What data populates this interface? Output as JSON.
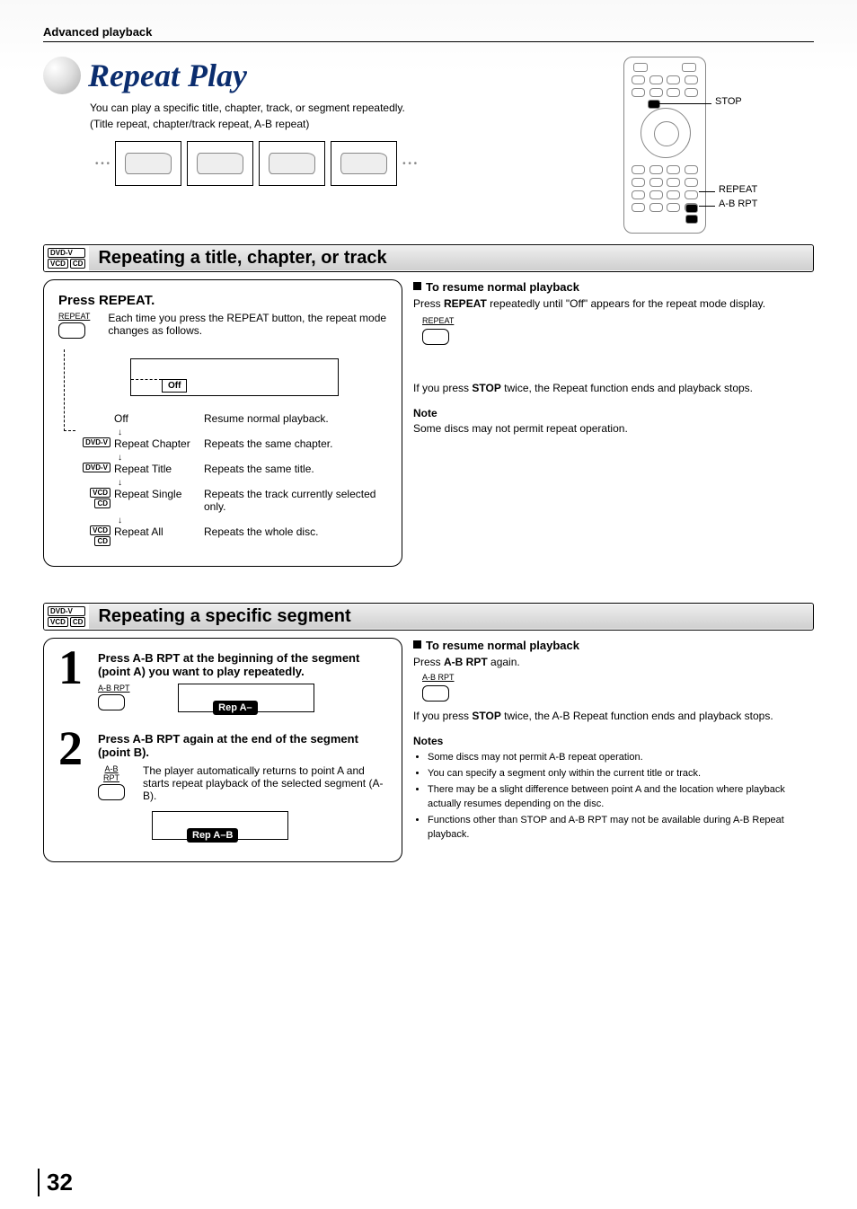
{
  "header": {
    "section": "Advanced playback"
  },
  "title": {
    "heading": "Repeat Play",
    "intro_l1": "You can play a specific title, chapter, track, or segment repeatedly.",
    "intro_l2": "(Title repeat, chapter/track repeat, A-B repeat)"
  },
  "remote": {
    "stop": "STOP",
    "repeat": "REPEAT",
    "abrpt": "A-B RPT"
  },
  "media_tags": {
    "dvdv": "DVD-V",
    "vcd": "VCD",
    "cd": "CD"
  },
  "section1": {
    "title": "Repeating a title, chapter, or track",
    "panel_head": "Press REPEAT.",
    "panel_body": "Each time you press the REPEAT button, the repeat mode changes as follows.",
    "btn_label": "REPEAT",
    "osd_off": "Off",
    "modes": {
      "off_name": "Off",
      "off_desc": "Resume normal playback.",
      "rc_name": "Repeat Chapter",
      "rc_desc": "Repeats the same chapter.",
      "rt_name": "Repeat Title",
      "rt_desc": "Repeats the same title.",
      "rs_name": "Repeat Single",
      "rs_desc": "Repeats the track currently selected only.",
      "ra_name": "Repeat All",
      "ra_desc": "Repeats the whole disc."
    },
    "right": {
      "resume_head": "To resume normal playback",
      "resume_body_a": "Press ",
      "resume_body_b": "REPEAT",
      "resume_body_c": " repeatedly until \"Off\" appears for the repeat mode display.",
      "btn_label": "REPEAT",
      "stop_body_a": "If you press ",
      "stop_body_b": "STOP",
      "stop_body_c": " twice, the Repeat function ends and playback stops.",
      "note_head": "Note",
      "note_body": "Some discs may not permit repeat operation."
    }
  },
  "section2": {
    "title": "Repeating a specific segment",
    "step1_num": "1",
    "step1_text": "Press A-B RPT at the beginning of the segment (point A) you want to play repeatedly.",
    "step1_btn": "A-B RPT",
    "step1_chip": "Rep A–",
    "step2_num": "2",
    "step2_text": "Press A-B RPT again at the end of the segment (point B).",
    "step2_btn": "A-B RPT",
    "step2_body": "The player automatically returns to point A and starts repeat playback of the selected segment (A-B).",
    "step2_chip": "Rep A–B",
    "right": {
      "resume_head": "To resume normal playback",
      "resume_body_a": "Press ",
      "resume_body_b": "A-B RPT",
      "resume_body_c": " again.",
      "btn_label": "A-B RPT",
      "stop_body_a": "If you press ",
      "stop_body_b": "STOP",
      "stop_body_c": " twice, the A-B Repeat function ends and playback stops.",
      "notes_head": "Notes",
      "n1": "Some discs may not permit A-B repeat operation.",
      "n2": "You can specify a segment only within the current title or track.",
      "n3": "There may be a slight difference between point A and the location where playback actually resumes depending on the disc.",
      "n4": "Functions other than STOP and A-B RPT may not be available during A-B Repeat playback."
    }
  },
  "page_number": "32"
}
